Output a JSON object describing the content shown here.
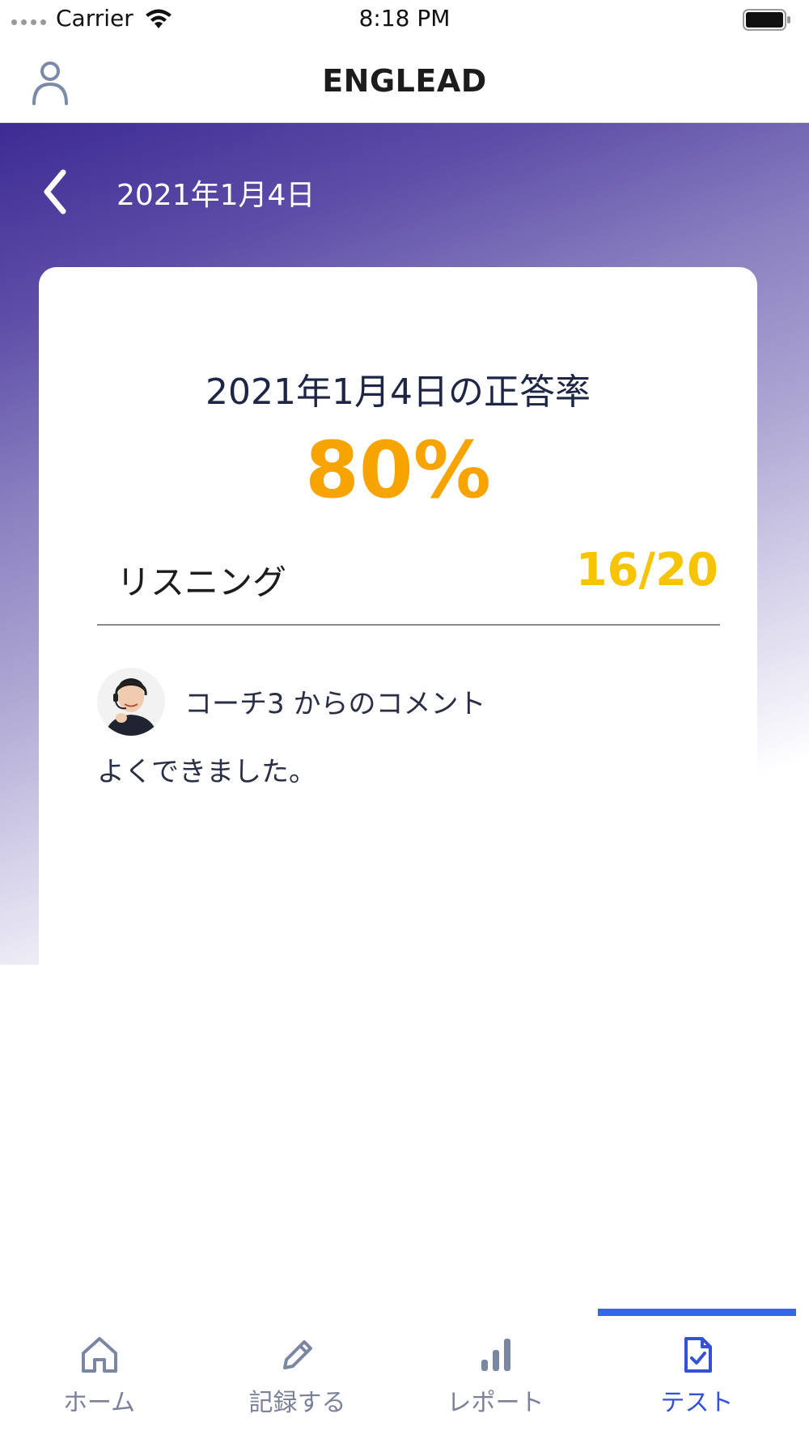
{
  "status_bar": {
    "carrier": "Carrier",
    "time": "8:18 PM"
  },
  "nav": {
    "title": "ENGLEAD"
  },
  "hero": {
    "date": "2021年1月4日"
  },
  "result": {
    "heading": "2021年1月4日の正答率",
    "percent": "80%",
    "section_label": "リスニング",
    "score": "16/20"
  },
  "comment": {
    "coach_label": "コーチ3 からのコメント",
    "text": "よくできました。"
  },
  "tabs": [
    {
      "label": "ホーム",
      "icon": "home-icon",
      "active": false
    },
    {
      "label": "記録する",
      "icon": "pencil-icon",
      "active": false
    },
    {
      "label": "レポート",
      "icon": "bar-chart-icon",
      "active": false
    },
    {
      "label": "テスト",
      "icon": "test-document-icon",
      "active": true
    }
  ],
  "colors": {
    "accent": "#3352d6",
    "percent": "#f7a300",
    "score": "#f6c400",
    "gradient_top": "#3d2b93"
  }
}
